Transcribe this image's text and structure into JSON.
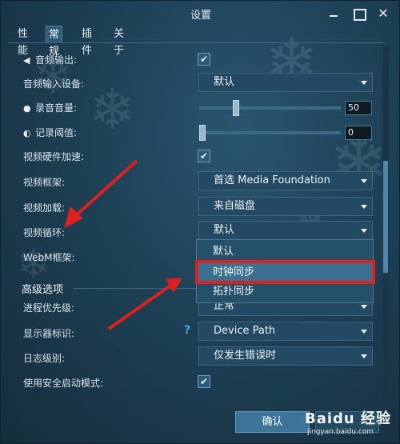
{
  "window": {
    "title": "设置"
  },
  "window_controls": {
    "close_glyph": "✕"
  },
  "tabs": [
    {
      "label": "性能"
    },
    {
      "label": "常规",
      "active": true
    },
    {
      "label": "插件"
    },
    {
      "label": "关于"
    }
  ],
  "settings": {
    "audio_output": {
      "label": "音频输出:",
      "checked": true,
      "check_glyph": "✔",
      "icon": "speaker-icon"
    },
    "audio_input_device": {
      "label": "音频输入设备:",
      "value": "默认"
    },
    "record_volume": {
      "label": "录音音量:",
      "value": "50",
      "level": 0.25,
      "icon": "microphone-icon"
    },
    "record_threshold": {
      "label": "记录阈值:",
      "value": "0",
      "level": 0.0,
      "icon": "gauge-icon"
    },
    "video_hw_accel": {
      "label": "视频硬件加速:",
      "checked": true,
      "check_glyph": "✔"
    },
    "video_framework": {
      "label": "视频框架:",
      "value": "首选 Media Foundation"
    },
    "video_loading": {
      "label": "视频加载:",
      "value": "来自磁盘"
    },
    "video_loop": {
      "label": "视频循环:",
      "value": "默认"
    },
    "webm_framework": {
      "label": "WebM框架:"
    }
  },
  "dropdown": {
    "options": [
      "默认",
      "时钟同步",
      "拓扑同步"
    ],
    "highlighted_index": 1
  },
  "advanced": {
    "title": "高级选项",
    "process_priority": {
      "label": "进程优先级:",
      "value": "正常"
    },
    "display_id": {
      "label": "显示器标识:",
      "value": "Device Path",
      "help_glyph": "?"
    },
    "log_level": {
      "label": "日志级别:",
      "value": "仅发生错误时"
    },
    "safe_start": {
      "label": "使用安全启动模式:",
      "checked": true,
      "check_glyph": "✔"
    }
  },
  "buttons": {
    "ok": "确认"
  },
  "watermark": {
    "text": "Baidu 经验",
    "url": "jingyan.baidu.com"
  },
  "annotation_color": "#e0201f"
}
